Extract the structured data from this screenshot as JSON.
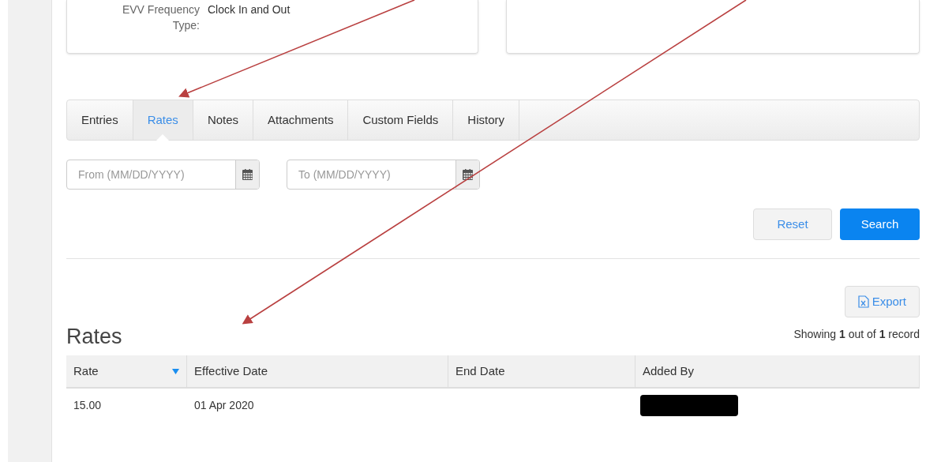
{
  "details_card": {
    "label": "EVV Frequency Type:",
    "value": "Clock In and Out"
  },
  "tabs": [
    {
      "label": "Entries",
      "selected": false
    },
    {
      "label": "Rates",
      "selected": true
    },
    {
      "label": "Notes",
      "selected": false
    },
    {
      "label": "Attachments",
      "selected": false
    },
    {
      "label": "Custom Fields",
      "selected": false
    },
    {
      "label": "History",
      "selected": false
    }
  ],
  "filters": [
    {
      "placeholder": "From (MM/DD/YYYY)"
    },
    {
      "placeholder": "To (MM/DD/YYYY)"
    }
  ],
  "buttons": [
    {
      "label": "Reset",
      "kind": "secondary"
    },
    {
      "label": "Search",
      "kind": "primary"
    }
  ],
  "export_button": "Export",
  "section_title": "Rates",
  "record_count": "Showing **1** out of **1** record",
  "table": {
    "columns": [
      {
        "label": "Rate",
        "sorted": true
      },
      {
        "label": "Effective Date",
        "sorted": false
      },
      {
        "label": "End Date",
        "sorted": false
      },
      {
        "label": "Added By",
        "sorted": false
      }
    ],
    "rows": [
      {
        "cells": [
          {
            "kind": "text",
            "text": "15.00"
          },
          {
            "kind": "text",
            "text": "01 Apr 2020"
          },
          {
            "kind": "blank"
          },
          {
            "kind": "redacted"
          }
        ]
      }
    ]
  }
}
